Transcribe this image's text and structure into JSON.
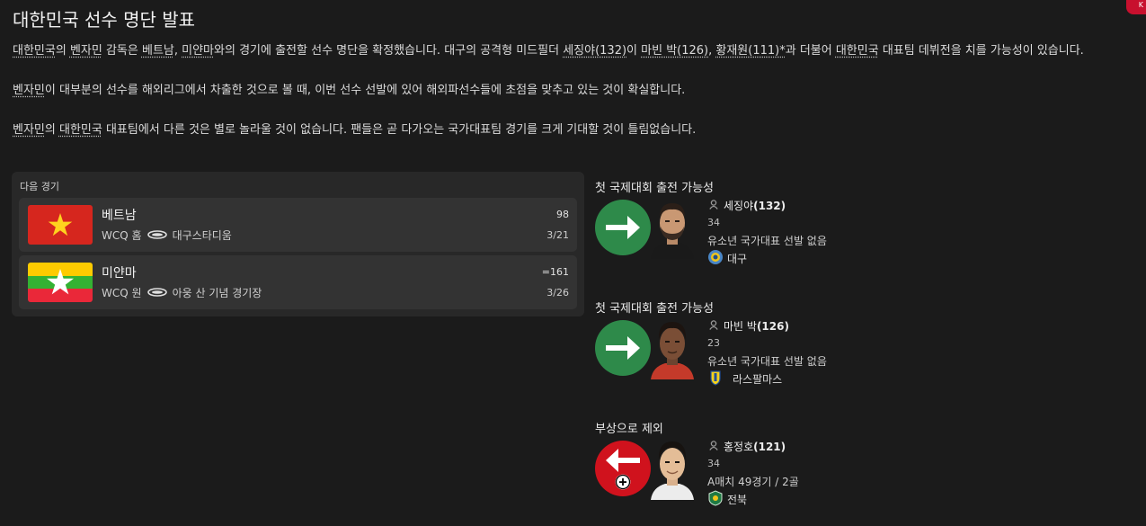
{
  "page": {
    "title": "대한민국 선수 명단 발표",
    "badge": "K"
  },
  "article": {
    "p1": {
      "s1": "대한민국",
      "s2": "의 ",
      "s3": "벤자민",
      "s4": " 감독은 ",
      "s5": "베트남",
      "s6": ", ",
      "s7": "미얀마",
      "s8": "와의 경기에 출전할 선수 명단을 확정했습니다. 대구의 공격형 미드필더 ",
      "s9": "세징야(132)",
      "s10": "이 ",
      "s11": "마빈 박(126)",
      "s12": ", ",
      "s13": "황재원(111)*",
      "s14": "과 더불어 ",
      "s15": "대한민국",
      "s16": " 대표팀 데뷔전을 치를 가능성이 있습니다."
    },
    "p2": {
      "s1": "벤자민",
      "s2": "이 대부분의 선수를 해외리그에서 차출한 것으로 볼 때, 이번 선수 선발에 있어 해외파선수들에 초점을 맞추고 있는 것이 확실합니다."
    },
    "p3": {
      "s1": "벤자민",
      "s2": "의 ",
      "s3": "대한민국",
      "s4": " 대표팀에서 다른 것은 별로 놀라울 것이 없습니다. 팬들은 곧 다가오는 국가대표팀 경기를 크게 기대할 것이 틀림없습니다."
    }
  },
  "next_matches": {
    "title": "다음 경기",
    "matches": [
      {
        "opponent": "베트남",
        "competition": "WCQ",
        "venue_type": "홈",
        "stadium": "대구스타디움",
        "rank": "98",
        "date": "3/21",
        "flag": "vietnam-flag-icon"
      },
      {
        "opponent": "미얀마",
        "competition": "WCQ",
        "venue_type": "원",
        "stadium": "아웅 산 기념 경기장",
        "rank": "=161",
        "date": "3/26",
        "flag": "myanmar-flag-icon"
      }
    ]
  },
  "players": [
    {
      "status": "첫 국제대회 출전 가능성",
      "name": "세징야",
      "ability": "(132)",
      "age": "34",
      "caps": "유소년 국가대표 선발 없음",
      "club": "대구",
      "arrow": "arrow-right-icon",
      "color": "#2e8a4a"
    },
    {
      "status": "첫 국제대회 출전 가능성",
      "name": "마빈 박",
      "ability": "(126)",
      "age": "23",
      "caps": "유소년 국가대표 선발 없음",
      "club": "라스팔마스",
      "arrow": "arrow-right-icon",
      "color": "#2e8a4a"
    },
    {
      "status": "부상으로 제외",
      "name": "홍정호",
      "ability": "(121)",
      "age": "34",
      "caps": "A매치 49경기 / 2골",
      "club": "전북",
      "arrow": "arrow-left-icon",
      "color": "#d0121d"
    }
  ]
}
